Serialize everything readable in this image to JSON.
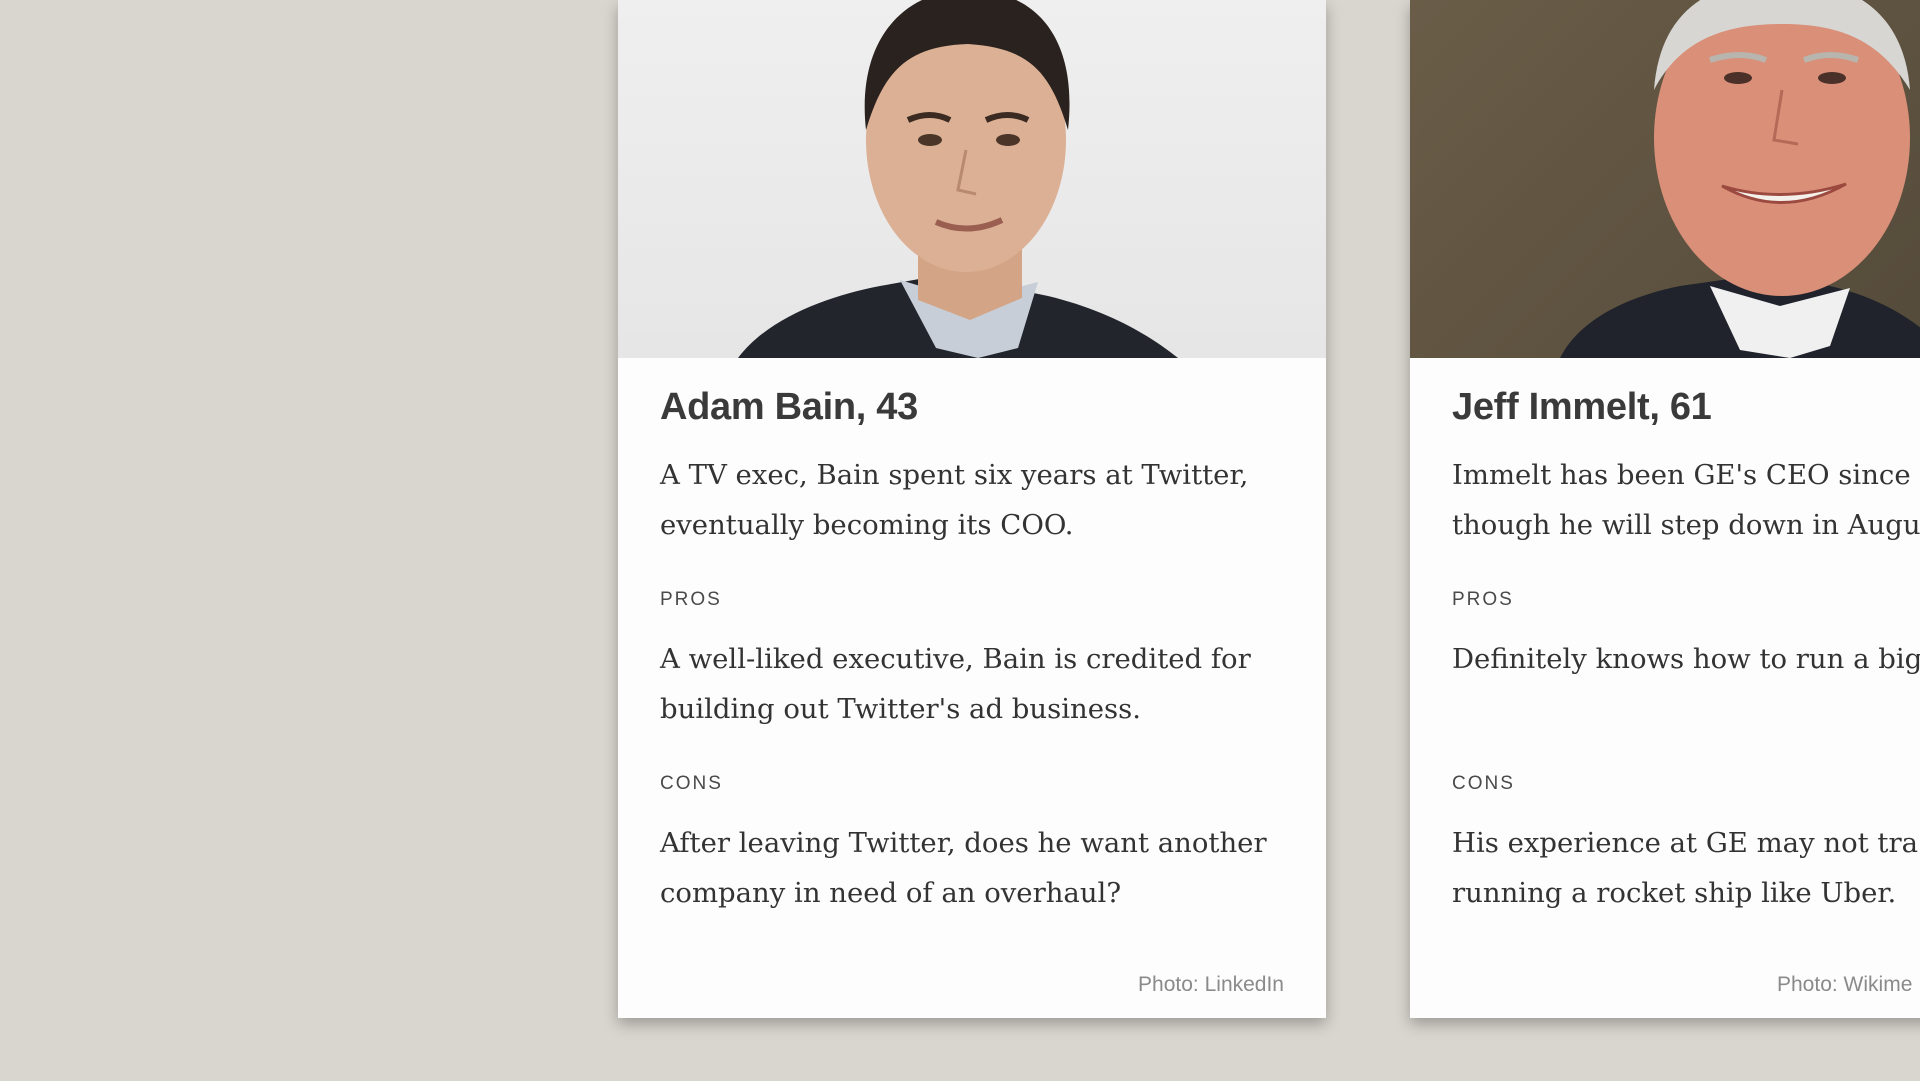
{
  "cards": [
    {
      "name": "Adam Bain, 43",
      "bio_line1": "A TV exec, Bain spent six years at Twitter,",
      "bio_line2": "eventually becoming its COO.",
      "pros_label": "PROS",
      "pros_line1": "A well-liked executive, Bain is credited for",
      "pros_line2": "building out Twitter's ad business.",
      "cons_label": "CONS",
      "cons_line1": "After leaving Twitter, does he want another",
      "cons_line2": "company in need of an overhaul?",
      "credit": "Photo: LinkedIn"
    },
    {
      "name": "Jeff Immelt, 61",
      "bio_line1": "Immelt has been GE's CEO since",
      "bio_line2": "though he will step down in Augu",
      "pros_label": "PROS",
      "pros_line1": "Definitely knows how to run a big",
      "pros_line2": "",
      "cons_label": "CONS",
      "cons_line1": "His experience at GE may not tra",
      "cons_line2": "running a rocket ship like Uber.",
      "credit": "Photo: Wikime"
    }
  ],
  "colors": {
    "page_background": "#d9d5cf",
    "card_background": "#fdfdfd",
    "name_text": "#3a3a3a",
    "body_text": "#333333",
    "credit_text": "#8a8a8a"
  }
}
